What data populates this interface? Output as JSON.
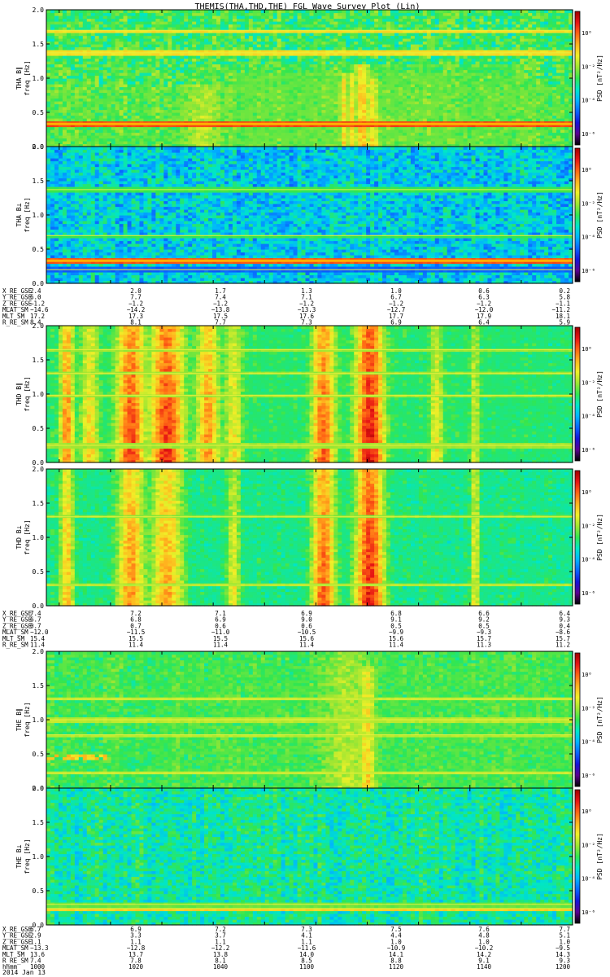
{
  "figure": {
    "title": "THEMIS(THA,THD,THE) FGL Wave Survey Plot (Lin)",
    "date_label": "2014 Jan 13"
  },
  "colors": {
    "colormap": [
      "#000000",
      "#5a0090",
      "#1414d8",
      "#0a64ff",
      "#00b4ff",
      "#00e6c8",
      "#32e650",
      "#a0e632",
      "#f0f028",
      "#ffb41e",
      "#ff6414",
      "#e61414",
      "#a00000"
    ],
    "orange_line": "#ffb000",
    "yellow_line": "#e6f03c"
  },
  "chart_data": [
    {
      "type": "heatmap",
      "title": "",
      "ylabel": "THA B∥\nfreq [Hz]",
      "ylabel_lines": [
        "THA B∥",
        "freq [Hz]"
      ],
      "ylim": [
        0,
        2.0
      ],
      "y_ticks": [
        "0.0",
        "0.5",
        "1.0",
        "1.5",
        "2.0"
      ],
      "colorbar": {
        "label": "PSD [nT²/Hz]",
        "ticks": [
          "10⁰",
          "10⁻²",
          "10⁻⁴",
          "10⁻⁶"
        ]
      },
      "xlim": [
        995,
        1200
      ],
      "base_level": 6.0,
      "noise": 1.0,
      "lines": [
        {
          "f": 0.33,
          "level": 10.4,
          "w": 0.03
        },
        {
          "f": 1.37,
          "level": 8.3,
          "w": 0.012
        },
        {
          "f": 1.7,
          "level": 8.3,
          "w": 0.012
        }
      ],
      "bursts": [
        {
          "t": 1056,
          "w": 7,
          "level": 7.5,
          "fmax": 0.9
        },
        {
          "t": 1111,
          "w": 1.5,
          "level": 8.5,
          "fmax": 1.1
        },
        {
          "t": 1114,
          "w": 1.5,
          "level": 8.5,
          "fmax": 1.1
        },
        {
          "t": 1118,
          "w": 2.5,
          "level": 9.0,
          "fmax": 1.2
        },
        {
          "t": 1122,
          "w": 2.5,
          "level": 8.5,
          "fmax": 1.0
        }
      ]
    },
    {
      "type": "heatmap",
      "title": "",
      "ylabel": "THA B⊥\nfreq [Hz]",
      "ylabel_lines": [
        "THA B⊥",
        "freq [Hz]"
      ],
      "ylim": [
        0,
        2.0
      ],
      "y_ticks": [
        "0.0",
        "0.5",
        "1.0",
        "1.5",
        "2.0"
      ],
      "colorbar": {
        "label": "PSD [nT²/Hz]",
        "ticks": [
          "10⁰",
          "10⁻²",
          "10⁻⁴",
          "10⁻⁶"
        ]
      },
      "xlim": [
        995,
        1200
      ],
      "base_level": 4.5,
      "noise": 1.2,
      "lines": [
        {
          "f": 0.33,
          "level": 10.2,
          "w": 0.02
        },
        {
          "f": 0.2,
          "level": 3.0,
          "w": 0.05
        },
        {
          "f": 0.7,
          "level": 6.0,
          "w": 0.02
        },
        {
          "f": 1.37,
          "level": 6.0,
          "w": 0.012
        }
      ],
      "bursts": []
    },
    {
      "type": "heatmap",
      "title": "",
      "ylabel": "THD B∥\nfreq [Hz]",
      "ylabel_lines": [
        "THD B∥",
        "freq [Hz]"
      ],
      "ylim": [
        0,
        2.0
      ],
      "y_ticks": [
        "0.0",
        "0.5",
        "1.0",
        "1.5",
        "2.0"
      ],
      "colorbar": {
        "label": "PSD [nT²/Hz]",
        "ticks": [
          "10⁰",
          "10⁻²",
          "10⁻⁴",
          "10⁻⁶"
        ]
      },
      "xlim": [
        995,
        1200
      ],
      "base_level": 5.2,
      "noise": 1.0,
      "lines": [
        {
          "f": 0.25,
          "level": 7.0,
          "w": 0.015
        },
        {
          "f": 0.98,
          "level": 7.0,
          "w": 0.015
        },
        {
          "f": 1.3,
          "level": 7.0,
          "w": 0.015
        },
        {
          "f": 1.65,
          "level": 7.0,
          "w": 0.015
        }
      ],
      "bursts": [
        {
          "t": 1003,
          "w": 3,
          "level": 9.8,
          "fmax": 2.0
        },
        {
          "t": 1012,
          "w": 4,
          "level": 8.5,
          "fmax": 2.0
        },
        {
          "t": 1028,
          "w": 6,
          "level": 10.6,
          "fmax": 2.0
        },
        {
          "t": 1042,
          "w": 7,
          "level": 10.9,
          "fmax": 2.0
        },
        {
          "t": 1058,
          "w": 5,
          "level": 9.5,
          "fmax": 2.0
        },
        {
          "t": 1068,
          "w": 4,
          "level": 8.3,
          "fmax": 2.0
        },
        {
          "t": 1103,
          "w": 5,
          "level": 10.2,
          "fmax": 2.0
        },
        {
          "t": 1121,
          "w": 6,
          "level": 11.3,
          "fmax": 2.0
        },
        {
          "t": 1147,
          "w": 3,
          "level": 8.2,
          "fmax": 2.0
        },
        {
          "t": 1162,
          "w": 2,
          "level": 7.8,
          "fmax": 2.0
        }
      ]
    },
    {
      "type": "heatmap",
      "title": "",
      "ylabel": "THD B⊥\nfreq [Hz]",
      "ylabel_lines": [
        "THD B⊥",
        "freq [Hz]"
      ],
      "ylim": [
        0,
        2.0
      ],
      "y_ticks": [
        "0.0",
        "0.5",
        "1.0",
        "1.5",
        "2.0"
      ],
      "colorbar": {
        "label": "PSD [nT²/Hz]",
        "ticks": [
          "10⁰",
          "10⁻²",
          "10⁻⁴",
          "10⁻⁶"
        ]
      },
      "xlim": [
        995,
        1200
      ],
      "base_level": 5.0,
      "noise": 1.0,
      "lines": [
        {
          "f": 0.3,
          "level": 7.0,
          "w": 0.012
        },
        {
          "f": 1.3,
          "level": 6.8,
          "w": 0.012
        }
      ],
      "bursts": [
        {
          "t": 1003,
          "w": 3,
          "level": 9.0,
          "fmax": 2.0
        },
        {
          "t": 1028,
          "w": 6,
          "level": 9.5,
          "fmax": 2.0
        },
        {
          "t": 1042,
          "w": 7,
          "level": 9.2,
          "fmax": 2.0
        },
        {
          "t": 1068,
          "w": 3,
          "level": 8.0,
          "fmax": 2.0
        },
        {
          "t": 1103,
          "w": 5,
          "level": 10.2,
          "fmax": 2.0
        },
        {
          "t": 1121,
          "w": 6,
          "level": 11.0,
          "fmax": 2.0
        },
        {
          "t": 1162,
          "w": 2,
          "level": 8.2,
          "fmax": 2.0
        }
      ]
    },
    {
      "type": "heatmap",
      "title": "",
      "ylabel": "THE B∥\nfreq [Hz]",
      "ylabel_lines": [
        "THE B∥",
        "freq [Hz]"
      ],
      "ylim": [
        0,
        2.0
      ],
      "y_ticks": [
        "0.0",
        "0.5",
        "1.0",
        "1.5",
        "2.0"
      ],
      "colorbar": {
        "label": "PSD [nT²/Hz]",
        "ticks": [
          "10⁰",
          "10⁻²",
          "10⁻⁴",
          "10⁻⁶"
        ]
      },
      "xlim": [
        995,
        1200
      ],
      "base_level": 5.8,
      "noise": 0.8,
      "lines": [
        {
          "f": 0.22,
          "level": 7.3,
          "w": 0.015
        },
        {
          "f": 0.78,
          "level": 7.3,
          "w": 0.015
        },
        {
          "f": 1.0,
          "level": 7.3,
          "w": 0.015
        },
        {
          "f": 1.3,
          "level": 7.3,
          "w": 0.015
        }
      ],
      "bursts": [
        {
          "t": 1112,
          "w": 10,
          "level": 7.4,
          "fmax": 2.0
        },
        {
          "t": 1120,
          "w": 3,
          "level": 8.6,
          "fmax": 1.8
        }
      ],
      "patches": [
        {
          "t0": 995,
          "t1": 1018,
          "f0": 0.4,
          "f1": 0.52,
          "level": 8.6
        }
      ]
    },
    {
      "type": "heatmap",
      "title": "",
      "ylabel": "THE B⊥\nfreq [Hz]",
      "ylabel_lines": [
        "THE B⊥",
        "freq [Hz]"
      ],
      "ylim": [
        0,
        2.0
      ],
      "y_ticks": [
        "0.0",
        "0.5",
        "1.0",
        "1.5",
        "2.0"
      ],
      "colorbar": {
        "label": "PSD [nT²/Hz]",
        "ticks": [
          "10⁰",
          "10⁻²",
          "10⁻⁴",
          "10⁻⁶"
        ]
      },
      "xlim": [
        995,
        1200
      ],
      "base_level": 5.3,
      "noise": 0.9,
      "lines": [
        {
          "f": 0.24,
          "level": 8.5,
          "w": 0.015
        },
        {
          "f": 0.3,
          "level": 6.5,
          "w": 0.03
        }
      ],
      "bursts": []
    }
  ],
  "ephem": [
    {
      "labels": [
        "X_RE_GSE",
        "Y_RE_GSE",
        "Z_RE_GSE",
        "MLAT_SM",
        "MLT_SM",
        "R_RE_SM"
      ],
      "columns": [
        [
          "2.4",
          "6.0",
          "−1.2",
          "−14.6",
          "17.2",
          "8.4"
        ],
        [
          "2.0",
          "7.7",
          "−1.2",
          "−14.2",
          "17.3",
          "8.1"
        ],
        [
          "1.7",
          "7.4",
          "−1.2",
          "−13.8",
          "17.5",
          "7.7"
        ],
        [
          "1.3",
          "7.1",
          "−1.2",
          "−13.3",
          "17.6",
          "7.3"
        ],
        [
          "1.0",
          "6.7",
          "−1.2",
          "−12.7",
          "17.7",
          "6.9"
        ],
        [
          "0.6",
          "6.3",
          "−1.2",
          "−12.0",
          "17.9",
          "6.4"
        ],
        [
          "0.2",
          "5.8",
          "−1.1",
          "−11.2",
          "18.1",
          "5.9"
        ]
      ]
    },
    {
      "labels": [
        "X_RE_GSE",
        "Y_RE_GSE",
        "Z_RE_GSE",
        "MLAT_SM",
        "MLT_SM",
        "R_RE_SM"
      ],
      "columns": [
        [
          "7.4",
          "6.7",
          "0.7",
          "−12.0",
          "15.4",
          "11.4"
        ],
        [
          "7.2",
          "6.8",
          "0.7",
          "−11.5",
          "15.5",
          "11.4"
        ],
        [
          "7.1",
          "6.9",
          "0.6",
          "−11.0",
          "15.5",
          "11.4"
        ],
        [
          "6.9",
          "9.0",
          "0.6",
          "−10.5",
          "15.6",
          "11.4"
        ],
        [
          "6.8",
          "9.1",
          "0.5",
          "−9.9",
          "15.6",
          "11.4"
        ],
        [
          "6.6",
          "9.2",
          "0.5",
          "−9.3",
          "15.7",
          "11.3"
        ],
        [
          "6.4",
          "9.3",
          "0.4",
          "−8.6",
          "15.7",
          "11.2"
        ]
      ]
    },
    {
      "labels": [
        "X_RE_GSE",
        "Y_RE_GSE",
        "Z_RE_GSE",
        "MLAT_SM",
        "MLT_SM",
        "R_RE_SM",
        "hhmm"
      ],
      "columns": [
        [
          "6.7",
          "2.9",
          "1.1",
          "−13.3",
          "13.6",
          "7.4",
          "1000"
        ],
        [
          "6.9",
          "3.3",
          "1.1",
          "−12.8",
          "13.7",
          "7.8",
          "1020"
        ],
        [
          "7.2",
          "3.7",
          "1.1",
          "−12.2",
          "13.8",
          "8.1",
          "1040"
        ],
        [
          "7.3",
          "4.1",
          "1.1",
          "−11.6",
          "14.0",
          "8.5",
          "1100"
        ],
        [
          "7.5",
          "4.4",
          "1.0",
          "−10.9",
          "14.1",
          "8.8",
          "1120"
        ],
        [
          "7.6",
          "4.8",
          "1.0",
          "−10.2",
          "14.2",
          "9.1",
          "1140"
        ],
        [
          "7.7",
          "5.1",
          "1.0",
          "−9.5",
          "14.3",
          "9.3",
          "1200"
        ]
      ]
    }
  ]
}
